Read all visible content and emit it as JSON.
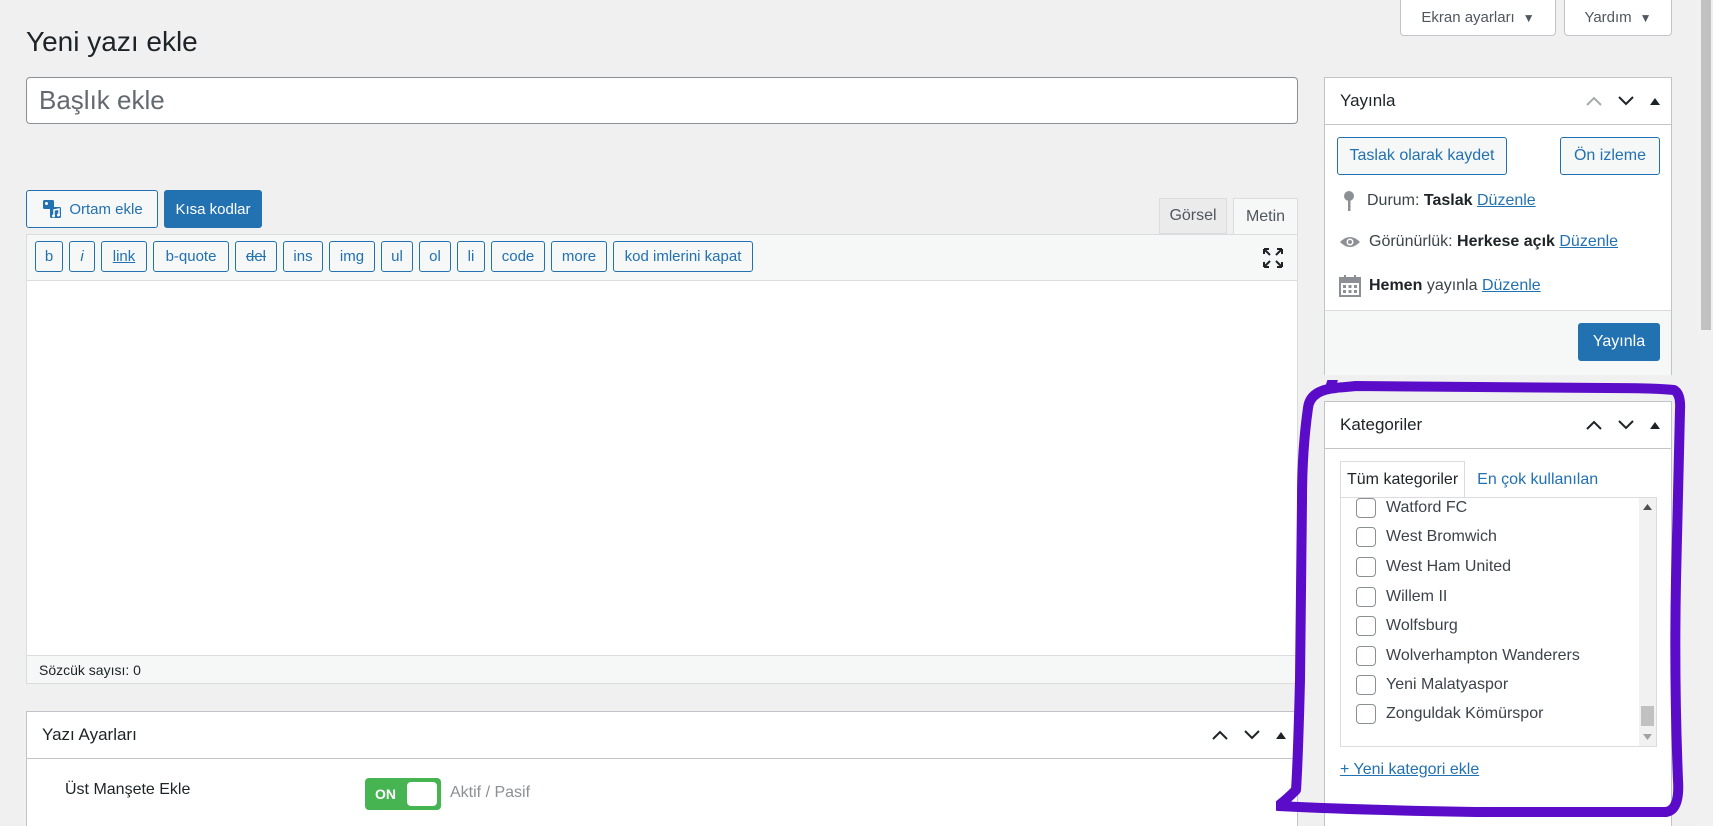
{
  "screen_options": {
    "label": "Ekran ayarları"
  },
  "help": {
    "label": "Yardım"
  },
  "page_title": "Yeni yazı ekle",
  "title_input": {
    "placeholder": "Başlık ekle"
  },
  "media_button": "Ortam ekle",
  "shortcodes_button": "Kısa kodlar",
  "editor_tabs": {
    "visual": "Görsel",
    "text": "Metin"
  },
  "quicktags": [
    "b",
    "i",
    "link",
    "b-quote",
    "del",
    "ins",
    "img",
    "ul",
    "ol",
    "li",
    "code",
    "more",
    "kod imlerini kapat"
  ],
  "word_count": "Sözcük sayısı: 0",
  "post_settings": {
    "title": "Yazı Ayarları",
    "toggle_label": "Üst Manşete Ekle",
    "toggle_state": "ON",
    "toggle_hint": "Aktif / Pasif"
  },
  "publish": {
    "title": "Yayınla",
    "save_draft": "Taslak olarak kaydet",
    "preview": "Ön izleme",
    "status_label": "Durum:",
    "status_value": "Taslak",
    "visibility_label": "Görünürlük:",
    "visibility_value": "Herkese açık",
    "schedule_bold": "Hemen",
    "schedule_label": "yayınla",
    "edit_link": "Düzenle",
    "publish_button": "Yayınla"
  },
  "categories": {
    "title": "Kategoriler",
    "tab_all": "Tüm kategoriler",
    "tab_popular": "En çok kullanılan",
    "items": [
      "Watford FC",
      "West Bromwich",
      "West Ham United",
      "Willem II",
      "Wolfsburg",
      "Wolverhampton Wanderers",
      "Yeni Malatyaspor",
      "Zonguldak Kömürspor"
    ],
    "add_new": "+ Yeni kategori ekle"
  },
  "colors": {
    "accent": "#2271b1",
    "toggle_on": "#46b450",
    "annotation": "#5b0cc9"
  }
}
